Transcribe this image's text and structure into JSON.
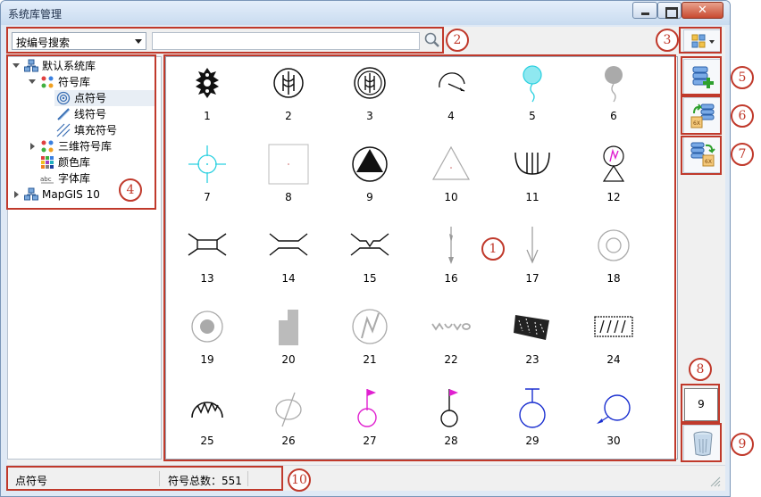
{
  "window": {
    "title": "系统库管理"
  },
  "toolbar": {
    "search_mode": "按编号搜索",
    "search_value": "",
    "search_placeholder": ""
  },
  "tree": {
    "items": [
      {
        "label": "默认系统库",
        "icon": "library-icon",
        "state": "open"
      },
      {
        "label": "符号库",
        "icon": "symbol-library-icon",
        "state": "open"
      },
      {
        "label": "点符号",
        "icon": "point-symbol-icon",
        "state": "selected"
      },
      {
        "label": "线符号",
        "icon": "line-symbol-icon",
        "state": "none"
      },
      {
        "label": "填充符号",
        "icon": "fill-symbol-icon",
        "state": "none"
      },
      {
        "label": "三维符号库",
        "icon": "3d-symbol-library-icon",
        "state": "closed"
      },
      {
        "label": "颜色库",
        "icon": "color-library-icon",
        "state": "none"
      },
      {
        "label": "字体库",
        "icon": "font-library-icon",
        "state": "none"
      },
      {
        "label": "MapGIS 10",
        "icon": "library-icon",
        "state": "closed"
      }
    ]
  },
  "symbols": [
    "1",
    "2",
    "3",
    "4",
    "5",
    "6",
    "7",
    "8",
    "9",
    "10",
    "11",
    "12",
    "13",
    "14",
    "15",
    "16",
    "17",
    "18",
    "19",
    "20",
    "21",
    "22",
    "23",
    "24",
    "25",
    "26",
    "27",
    "28",
    "29",
    "30"
  ],
  "right_panel": {
    "count_value": "9"
  },
  "status": {
    "left": "点符号",
    "right": "符号总数：551"
  },
  "callouts": [
    "1",
    "2",
    "3",
    "4",
    "5",
    "6",
    "7",
    "8",
    "9",
    "10"
  ],
  "colors": {
    "callout": "#c0392b",
    "cyan": "#2ad0e0",
    "magenta": "#e020d0",
    "blue": "#1a2fd0",
    "selection": "#e8eef5"
  }
}
